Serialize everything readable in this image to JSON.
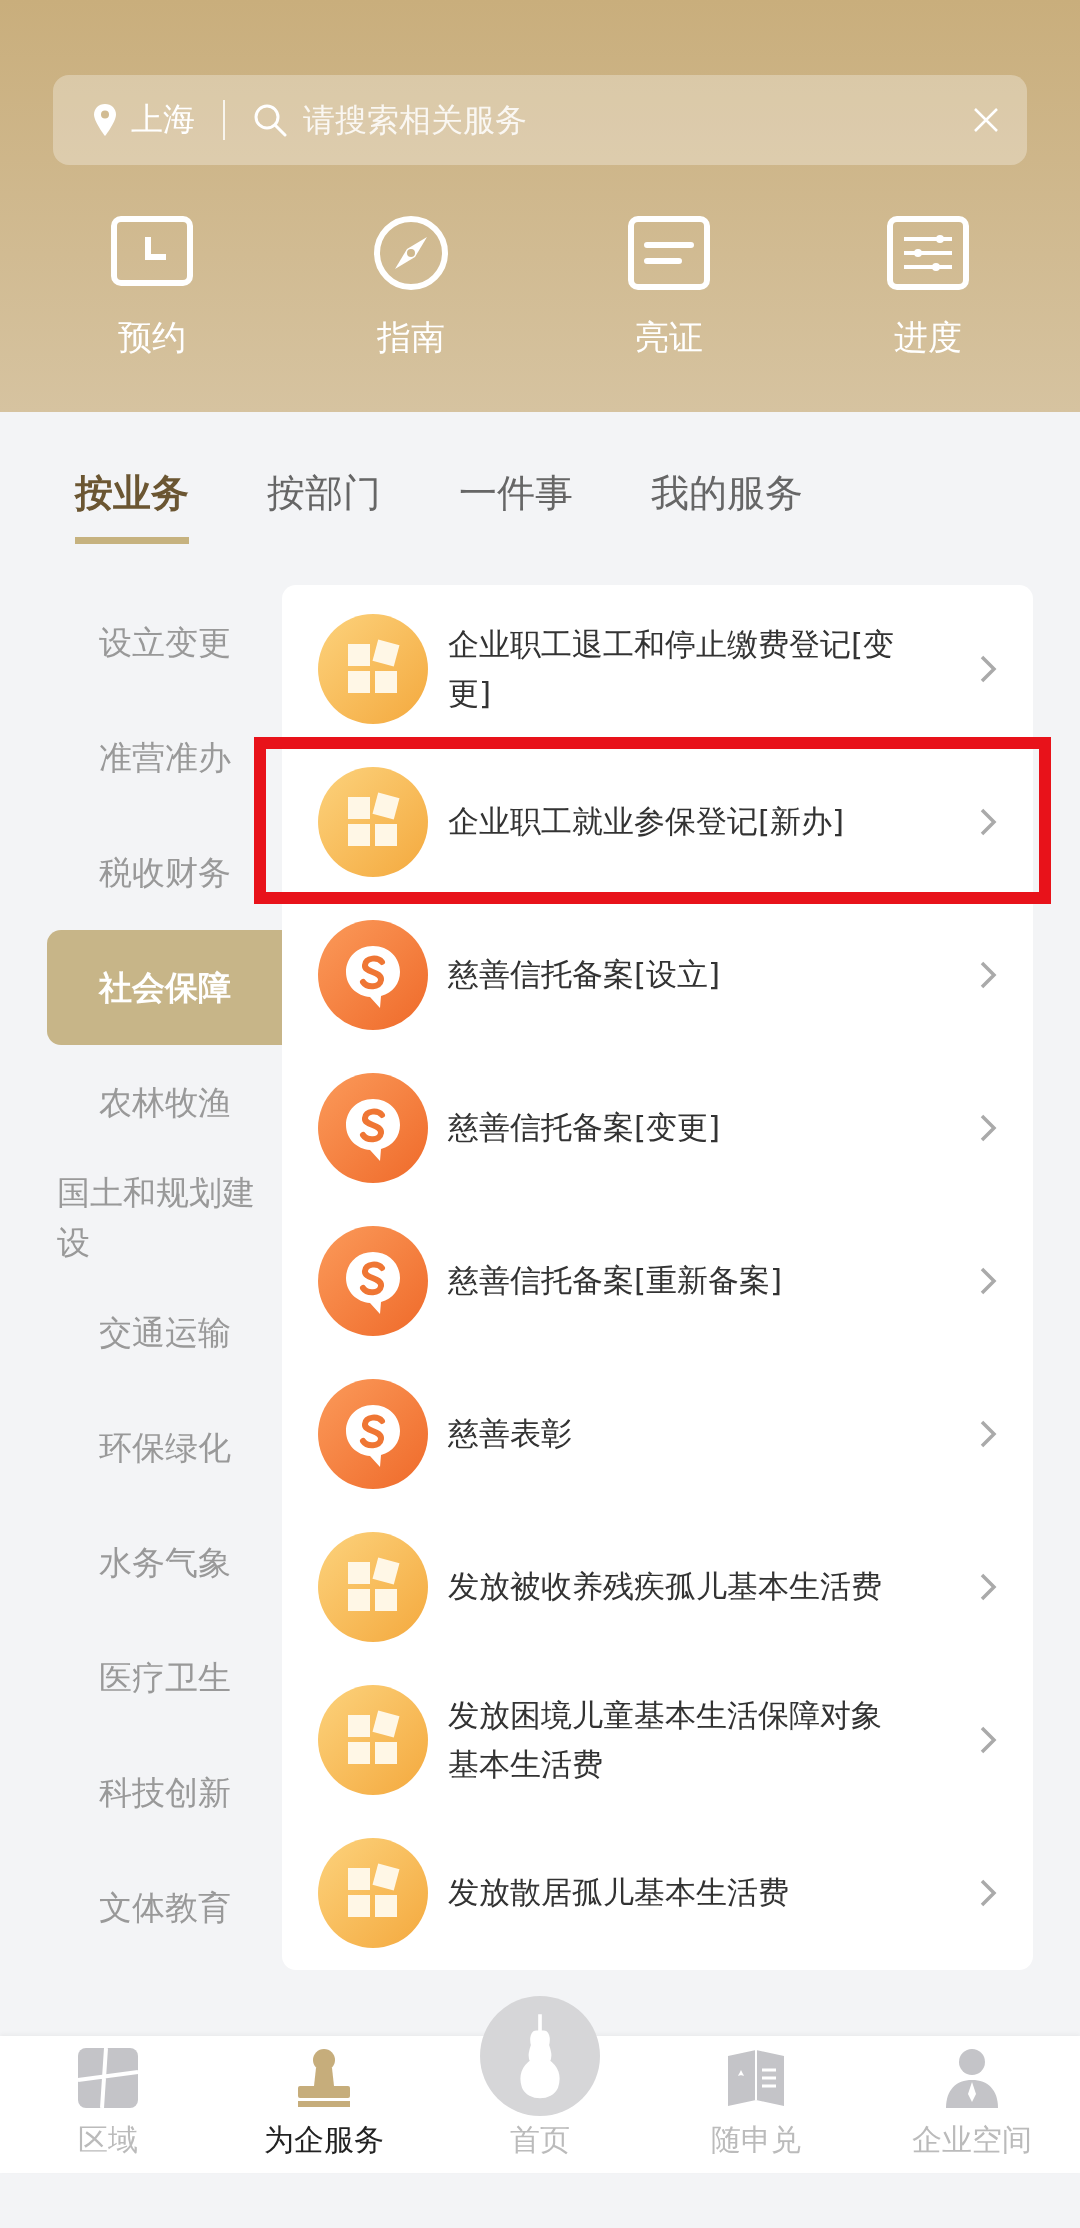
{
  "search": {
    "city": "上海",
    "placeholder": "请搜索相关服务"
  },
  "shortcuts": [
    {
      "kind": "clock",
      "label": "预约"
    },
    {
      "kind": "compass",
      "label": "指南"
    },
    {
      "kind": "card",
      "label": "亮证"
    },
    {
      "kind": "progress",
      "label": "进度"
    }
  ],
  "tabs": [
    {
      "label": "按业务",
      "selected": true
    },
    {
      "label": "按部门",
      "selected": false
    },
    {
      "label": "一件事",
      "selected": false
    },
    {
      "label": "我的服务",
      "selected": false
    }
  ],
  "sidebar": {
    "items": [
      {
        "label": "设立变更",
        "selected": false
      },
      {
        "label": "准营准办",
        "selected": false
      },
      {
        "label": "税收财务",
        "selected": false
      },
      {
        "label": "社会保障",
        "selected": true
      },
      {
        "label": "农林牧渔",
        "selected": false
      },
      {
        "label": "国土和规划建设",
        "selected": false
      },
      {
        "label": "交通运输",
        "selected": false
      },
      {
        "label": "环保绿化",
        "selected": false
      },
      {
        "label": "水务气象",
        "selected": false
      },
      {
        "label": "医疗卫生",
        "selected": false
      },
      {
        "label": "科技创新",
        "selected": false
      },
      {
        "label": "文体教育",
        "selected": false
      }
    ]
  },
  "services": [
    {
      "kind": "grid",
      "title": "企业职工退工和停止缴费登记[变更]",
      "highlighted": false
    },
    {
      "kind": "grid",
      "title": "企业职工就业参保登记[新办]",
      "highlighted": true
    },
    {
      "kind": "charity",
      "title": "慈善信托备案[设立]",
      "highlighted": false
    },
    {
      "kind": "charity",
      "title": "慈善信托备案[变更]",
      "highlighted": false
    },
    {
      "kind": "charity",
      "title": "慈善信托备案[重新备案]",
      "highlighted": false
    },
    {
      "kind": "charity",
      "title": "慈善表彰",
      "highlighted": false
    },
    {
      "kind": "grid",
      "title": "发放被收养残疾孤儿基本生活费",
      "highlighted": false
    },
    {
      "kind": "grid",
      "title": "发放困境儿童基本生活保障对象基本生活费",
      "highlighted": false
    },
    {
      "kind": "grid",
      "title": "发放散居孤儿基本生活费",
      "highlighted": false
    }
  ],
  "bottom_nav": [
    {
      "kind": "map",
      "label": "区域",
      "selected": false
    },
    {
      "kind": "stamp",
      "label": "为企服务",
      "selected": true
    },
    {
      "kind": "home",
      "label": "首页",
      "selected": false
    },
    {
      "kind": "book",
      "label": "随申兑",
      "selected": false
    },
    {
      "kind": "person",
      "label": "企业空间",
      "selected": false
    }
  ]
}
